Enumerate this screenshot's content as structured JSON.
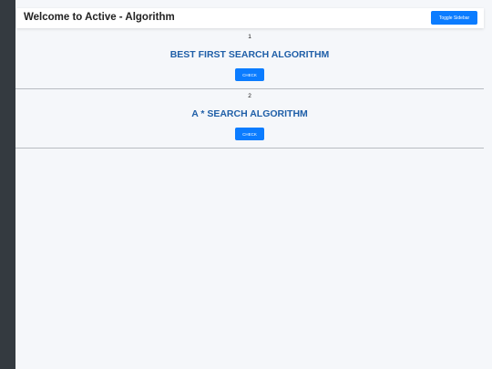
{
  "header": {
    "title": "Welcome to Active - Algorithm",
    "toggle_label": "Toggle Sidebar"
  },
  "algorithms": [
    {
      "number": "1",
      "name": "BEST FIRST SEARCH ALGORITHM",
      "button_label": "CHECK"
    },
    {
      "number": "2",
      "name": "A * SEARCH ALGORITHM",
      "button_label": "CHECK"
    }
  ],
  "colors": {
    "sidebar": "#343a40",
    "accent": "#0b7cff",
    "title_blue": "#1f5fa8",
    "background": "#f5f7fa"
  }
}
